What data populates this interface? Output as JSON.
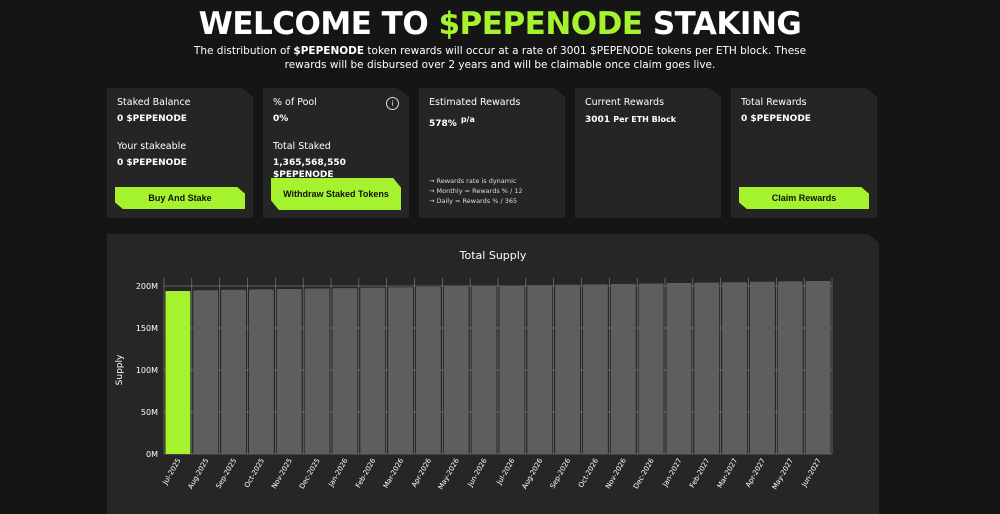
{
  "header": {
    "title_prefix": "WELCOME TO ",
    "title_accent": "$PEPENODE",
    "title_suffix": " STAKING",
    "subtitle_part1": "The distribution of ",
    "subtitle_token": "$PEPENODE",
    "subtitle_part2": " token rewards will occur at a rate of 3001 $PEPENODE tokens per ETH block. These rewards will be disbursed over 2 years and will be claimable once claim goes live."
  },
  "cards": {
    "staked": {
      "balance_label": "Staked Balance",
      "balance_value": "0 $PEPENODE",
      "stakeable_label": "Your stakeable",
      "stakeable_value": "0 $PEPENODE",
      "button": "Buy And Stake"
    },
    "pool": {
      "pool_label": "% of Pool",
      "pool_value": "0%",
      "info_icon": "i",
      "total_label": "Total Staked",
      "total_value": "1,365,568,550 $PEPENODE",
      "button": "Withdraw Staked Tokens"
    },
    "estimated": {
      "label": "Estimated Rewards",
      "value": "578%",
      "unit": "p/a",
      "notes": [
        "→ Rewards rate is dynamic",
        "→ Monthly = Rewards % / 12",
        "→ Daily = Rewards % / 365"
      ]
    },
    "current": {
      "label": "Current Rewards",
      "value": "3001",
      "unit": "Per ETH Block"
    },
    "total": {
      "label": "Total Rewards",
      "value": "0 $PEPENODE",
      "button": "Claim Rewards"
    }
  },
  "colors": {
    "accent": "#a4f32e",
    "bar_gray": "#5e5e5e",
    "panel": "#262626",
    "background": "#151515"
  },
  "chart_data": {
    "type": "bar",
    "title": "Total Supply",
    "ylabel": "Supply",
    "xlabel": "",
    "ylim": [
      0,
      200000000
    ],
    "yticks": [
      0,
      50000000,
      100000000,
      150000000,
      200000000
    ],
    "ytick_labels": [
      "0M",
      "50M",
      "100M",
      "150M",
      "200M"
    ],
    "grid": true,
    "highlight_index": 0,
    "categories": [
      "Jul-2025",
      "Aug-2025",
      "Sep-2025",
      "Oct-2025",
      "Nov-2025",
      "Dec-2025",
      "Jan-2026",
      "Feb-2026",
      "Mar-2026",
      "Apr-2026",
      "May-2026",
      "Jun-2026",
      "Jul-2026",
      "Aug-2026",
      "Sep-2026",
      "Oct-2026",
      "Nov-2026",
      "Dec-2026",
      "Jan-2027",
      "Feb-2027",
      "Mar-2027",
      "Apr-2027",
      "May-2027",
      "Jun-2027"
    ],
    "values": [
      194000000,
      195000000,
      195500000,
      196000000,
      196500000,
      197000000,
      197500000,
      198000000,
      198500000,
      199000000,
      199500000,
      200000000,
      200500000,
      201000000,
      201500000,
      202000000,
      202500000,
      203000000,
      203500000,
      204000000,
      204500000,
      205000000,
      205500000,
      206000000
    ]
  }
}
